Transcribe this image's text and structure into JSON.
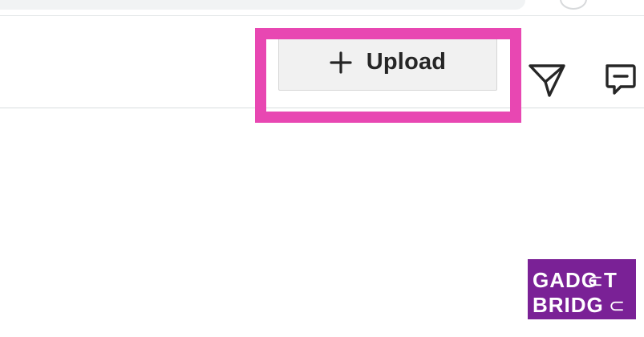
{
  "toolbar": {
    "upload_label": "Upload",
    "icons": {
      "plus": "plus-icon",
      "send": "send-icon",
      "comment": "comment-icon"
    }
  },
  "watermark": {
    "line1": "GADG T",
    "line2": "BRIDG",
    "text": "GADGET BRIDGE"
  },
  "colors": {
    "highlight": "#e847b2",
    "button_bg": "#f1f1f1",
    "logo_bg": "#7a2196",
    "divider": "#d9dde0"
  }
}
